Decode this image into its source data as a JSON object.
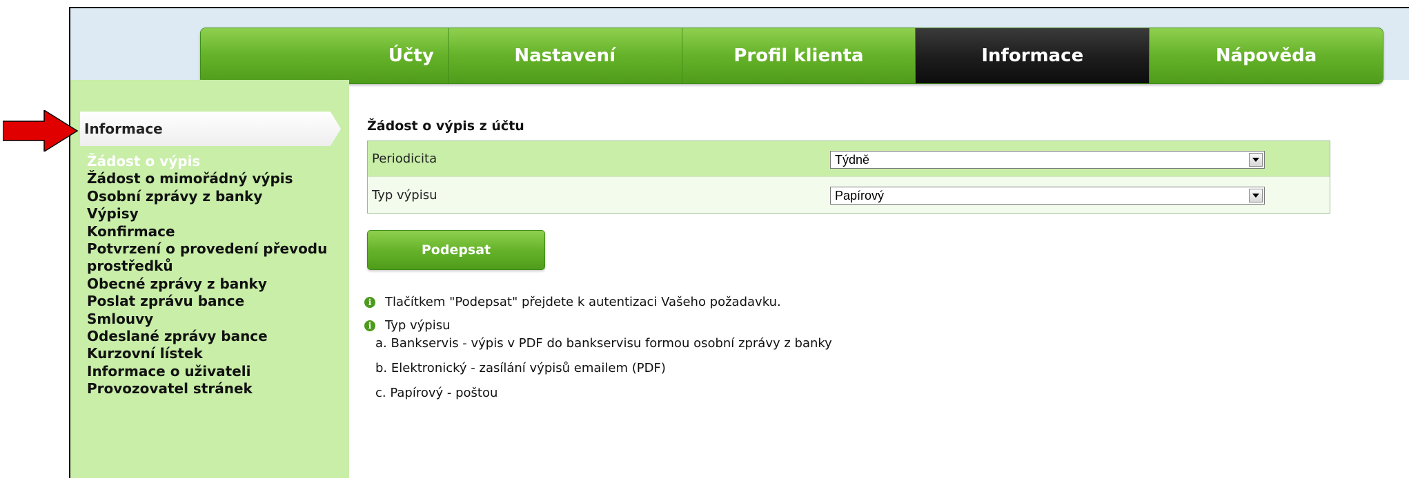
{
  "nav": {
    "tabs": [
      {
        "label": "Účty"
      },
      {
        "label": "Nastavení"
      },
      {
        "label": "Profil klienta"
      },
      {
        "label": "Informace",
        "active": true
      },
      {
        "label": "Nápověda"
      }
    ]
  },
  "sidebar": {
    "heading": "Informace",
    "items": [
      {
        "label": "Žádost o výpis",
        "selected": true
      },
      {
        "label": "Žádost o mimořádný výpis"
      },
      {
        "label": "Osobní zprávy z banky"
      },
      {
        "label": "Výpisy"
      },
      {
        "label": "Konfirmace"
      },
      {
        "label": "Potvrzení o provedení převodu"
      },
      {
        "label": "prostředků"
      },
      {
        "label": "Obecné zprávy z banky"
      },
      {
        "label": "Poslat zprávu bance"
      },
      {
        "label": "Smlouvy"
      },
      {
        "label": "Odeslané zprávy bance"
      },
      {
        "label": "Kurzovní lístek"
      },
      {
        "label": "Informace o uživateli"
      },
      {
        "label": "Provozovatel stránek"
      }
    ]
  },
  "form": {
    "title": "Žádost o výpis z účtu",
    "periodicity_label": "Periodicita",
    "periodicity_value": "Týdně",
    "type_label": "Typ výpisu",
    "type_value": "Papírový",
    "sign_button": "Podepsat"
  },
  "info": {
    "line1": "Tlačítkem \"Podepsat\" přejdete k autentizaci Vašeho požadavku.",
    "line2": "Typ výpisu",
    "option_a": "a.  Bankservis - výpis v PDF do bankservisu formou osobní zprávy z banky",
    "option_b": "b.  Elektronický - zasílání výpisů emailem (PDF)",
    "option_c": "c.  Papírový - poštou"
  },
  "colors": {
    "nav_green": "#66b32a",
    "nav_active": "#1c1c1c",
    "sidebar_bg": "#c8eea8",
    "arrow_red": "#e00000"
  },
  "icons": {
    "info": "info-icon",
    "select_arrow": "chevron-down-icon",
    "annotation": "red-arrow-icon"
  }
}
